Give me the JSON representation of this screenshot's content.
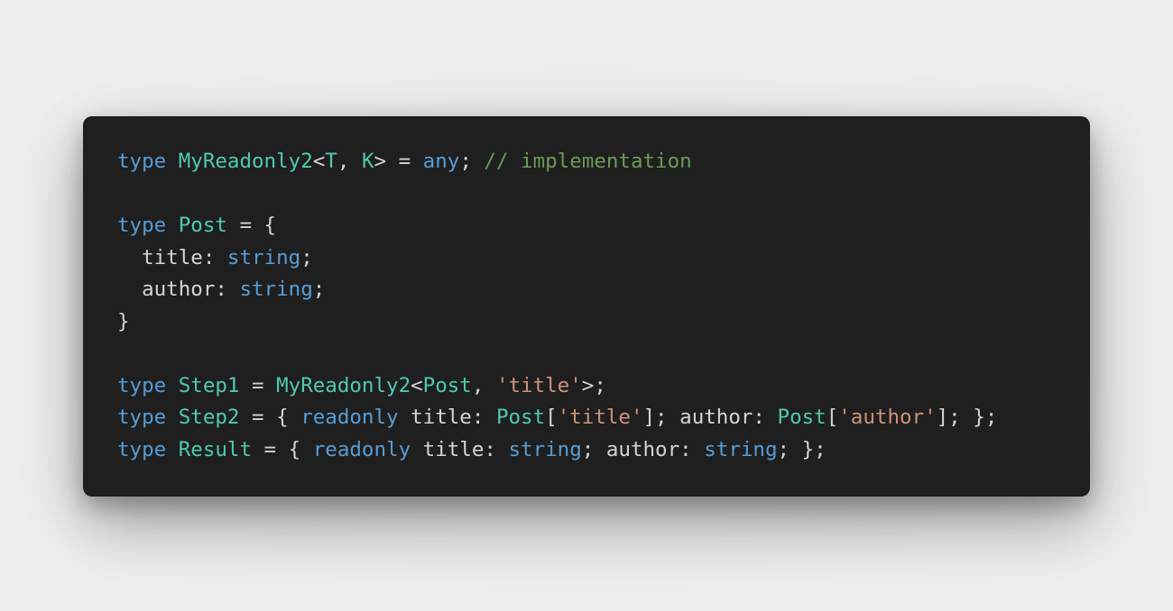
{
  "colors": {
    "background": "#ececec",
    "editor_background": "#1f1f1f",
    "keyword": "#569cd6",
    "type": "#4ec9b0",
    "string": "#ce9178",
    "comment": "#6a9955",
    "plain": "#d4d4d4"
  },
  "code": {
    "language": "typescript",
    "lines": [
      [
        {
          "t": "keyword",
          "v": "type"
        },
        {
          "t": "plain",
          "v": " "
        },
        {
          "t": "type",
          "v": "MyReadonly2"
        },
        {
          "t": "plain",
          "v": "<"
        },
        {
          "t": "type",
          "v": "T"
        },
        {
          "t": "plain",
          "v": ", "
        },
        {
          "t": "type",
          "v": "K"
        },
        {
          "t": "plain",
          "v": "> = "
        },
        {
          "t": "keyword",
          "v": "any"
        },
        {
          "t": "plain",
          "v": "; "
        },
        {
          "t": "comment",
          "v": "// implementation"
        }
      ],
      [],
      [
        {
          "t": "keyword",
          "v": "type"
        },
        {
          "t": "plain",
          "v": " "
        },
        {
          "t": "type",
          "v": "Post"
        },
        {
          "t": "plain",
          "v": " = {"
        }
      ],
      [
        {
          "t": "plain",
          "v": "  title: "
        },
        {
          "t": "keyword",
          "v": "string"
        },
        {
          "t": "plain",
          "v": ";"
        }
      ],
      [
        {
          "t": "plain",
          "v": "  author: "
        },
        {
          "t": "keyword",
          "v": "string"
        },
        {
          "t": "plain",
          "v": ";"
        }
      ],
      [
        {
          "t": "plain",
          "v": "}"
        }
      ],
      [],
      [
        {
          "t": "keyword",
          "v": "type"
        },
        {
          "t": "plain",
          "v": " "
        },
        {
          "t": "type",
          "v": "Step1"
        },
        {
          "t": "plain",
          "v": " = "
        },
        {
          "t": "type",
          "v": "MyReadonly2"
        },
        {
          "t": "plain",
          "v": "<"
        },
        {
          "t": "type",
          "v": "Post"
        },
        {
          "t": "plain",
          "v": ", "
        },
        {
          "t": "string",
          "v": "'title'"
        },
        {
          "t": "plain",
          "v": ">;"
        }
      ],
      [
        {
          "t": "keyword",
          "v": "type"
        },
        {
          "t": "plain",
          "v": " "
        },
        {
          "t": "type",
          "v": "Step2"
        },
        {
          "t": "plain",
          "v": " = { "
        },
        {
          "t": "keyword",
          "v": "readonly"
        },
        {
          "t": "plain",
          "v": " title: "
        },
        {
          "t": "type",
          "v": "Post"
        },
        {
          "t": "plain",
          "v": "["
        },
        {
          "t": "string",
          "v": "'title'"
        },
        {
          "t": "plain",
          "v": "]; author: "
        },
        {
          "t": "type",
          "v": "Post"
        },
        {
          "t": "plain",
          "v": "["
        },
        {
          "t": "string",
          "v": "'author'"
        },
        {
          "t": "plain",
          "v": "]; };"
        }
      ],
      [
        {
          "t": "keyword",
          "v": "type"
        },
        {
          "t": "plain",
          "v": " "
        },
        {
          "t": "type",
          "v": "Result"
        },
        {
          "t": "plain",
          "v": " = { "
        },
        {
          "t": "keyword",
          "v": "readonly"
        },
        {
          "t": "plain",
          "v": " title: "
        },
        {
          "t": "keyword",
          "v": "string"
        },
        {
          "t": "plain",
          "v": "; author: "
        },
        {
          "t": "keyword",
          "v": "string"
        },
        {
          "t": "plain",
          "v": "; };"
        }
      ]
    ]
  }
}
